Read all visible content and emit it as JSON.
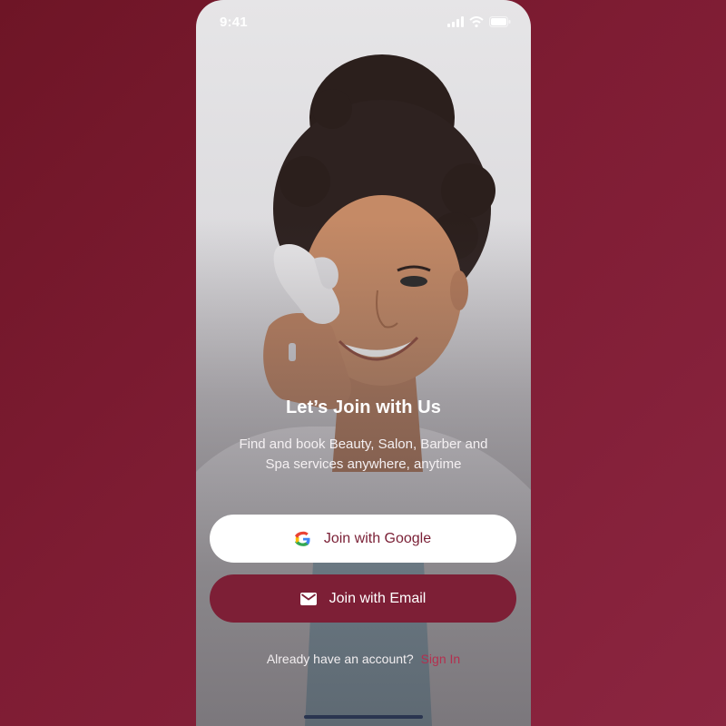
{
  "status_bar": {
    "time": "9:41",
    "icons": [
      "signal-icon",
      "wifi-icon",
      "battery-icon"
    ]
  },
  "hero": {
    "title": "Let’s Join with Us",
    "subtitle": "Find and book Beauty, Salon, Barber and Spa services anywhere, anytime"
  },
  "buttons": {
    "google_label": "Join with Google",
    "google_icon": "google-icon",
    "email_label": "Join with Email",
    "email_icon": "mail-icon"
  },
  "footer": {
    "prompt": "Already have an account?",
    "signin_label": "Sign In"
  },
  "colors": {
    "background": "#7e1c33",
    "primary": "#7d1f36",
    "link": "#b3304f",
    "google_button": "#ffffff"
  }
}
